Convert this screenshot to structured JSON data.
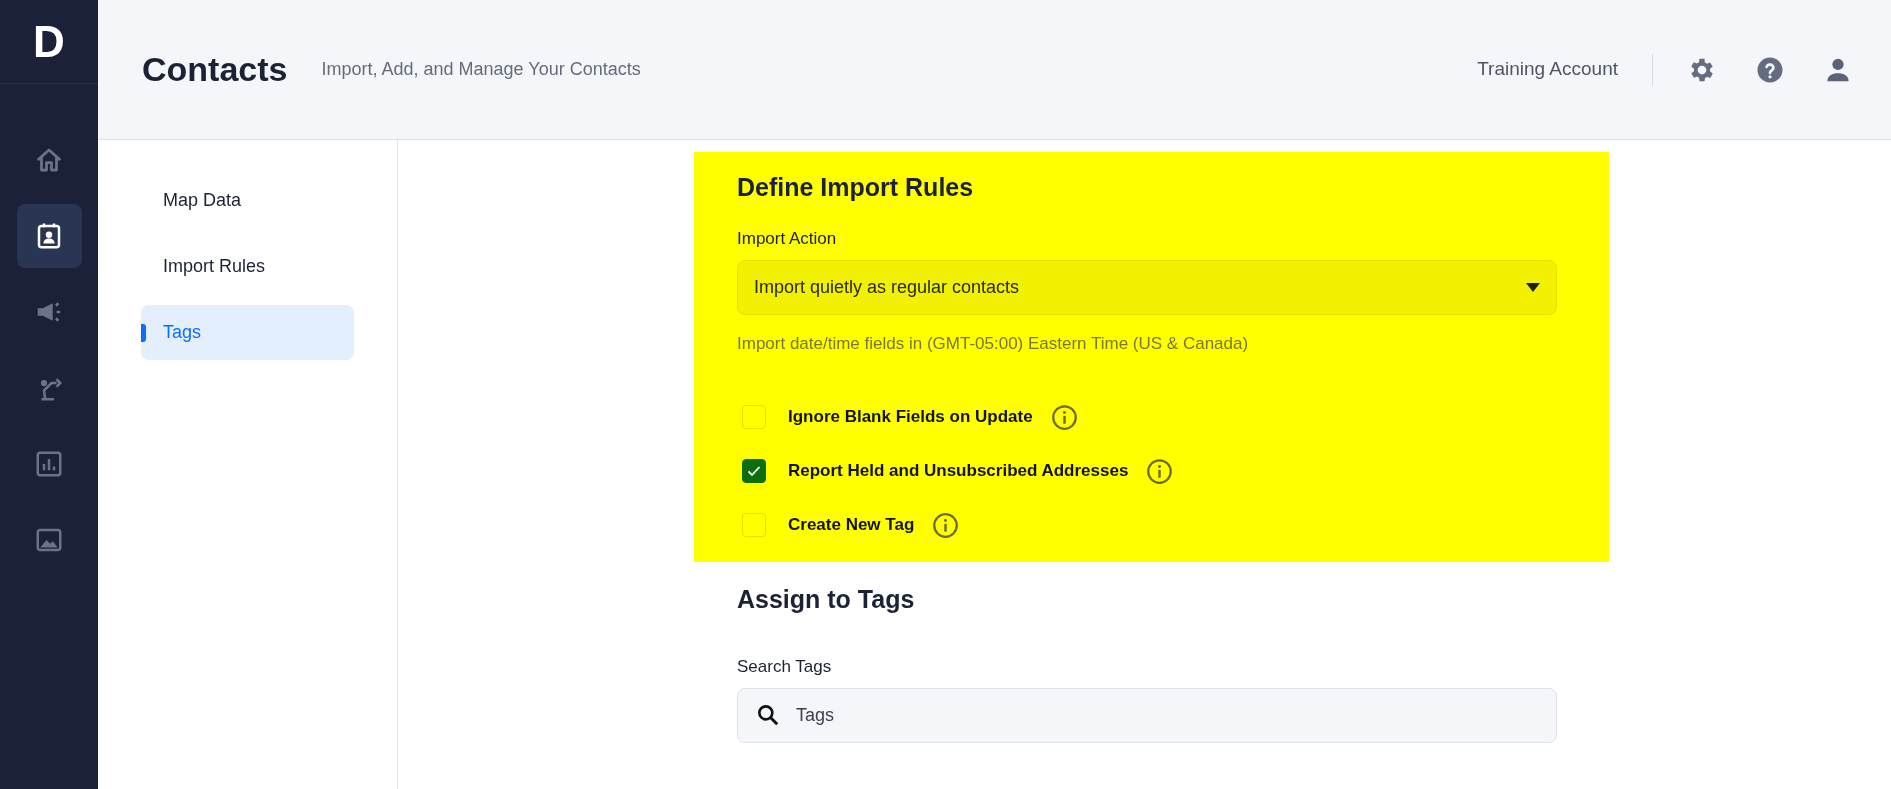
{
  "app": {
    "logo": "D"
  },
  "nav": [
    {
      "kind": "home",
      "selected": false
    },
    {
      "kind": "contacts",
      "selected": true
    },
    {
      "kind": "megaphone",
      "selected": false
    },
    {
      "kind": "robot-arm",
      "selected": false
    },
    {
      "kind": "chart",
      "selected": false
    },
    {
      "kind": "image",
      "selected": false
    }
  ],
  "header": {
    "title": "Contacts",
    "subtitle": "Import, Add, and Manage Your Contacts",
    "account": "Training Account"
  },
  "subnav": [
    {
      "label": "Map Data",
      "selected": false
    },
    {
      "label": "Import Rules",
      "selected": false
    },
    {
      "label": "Tags",
      "selected": true
    }
  ],
  "import_rules": {
    "title": "Define Import Rules",
    "action_label": "Import Action",
    "action_value": "Import quietly as regular contacts",
    "hint": "Import date/time fields in (GMT-05:00) Eastern Time (US & Canada)",
    "options": [
      {
        "label": "Ignore Blank Fields on Update",
        "checked": false
      },
      {
        "label": "Report Held and Unsubscribed Addresses",
        "checked": true
      },
      {
        "label": "Create New Tag",
        "checked": false
      }
    ]
  },
  "tags": {
    "title": "Assign to Tags",
    "search_label": "Search Tags",
    "search_placeholder": "Tags"
  }
}
